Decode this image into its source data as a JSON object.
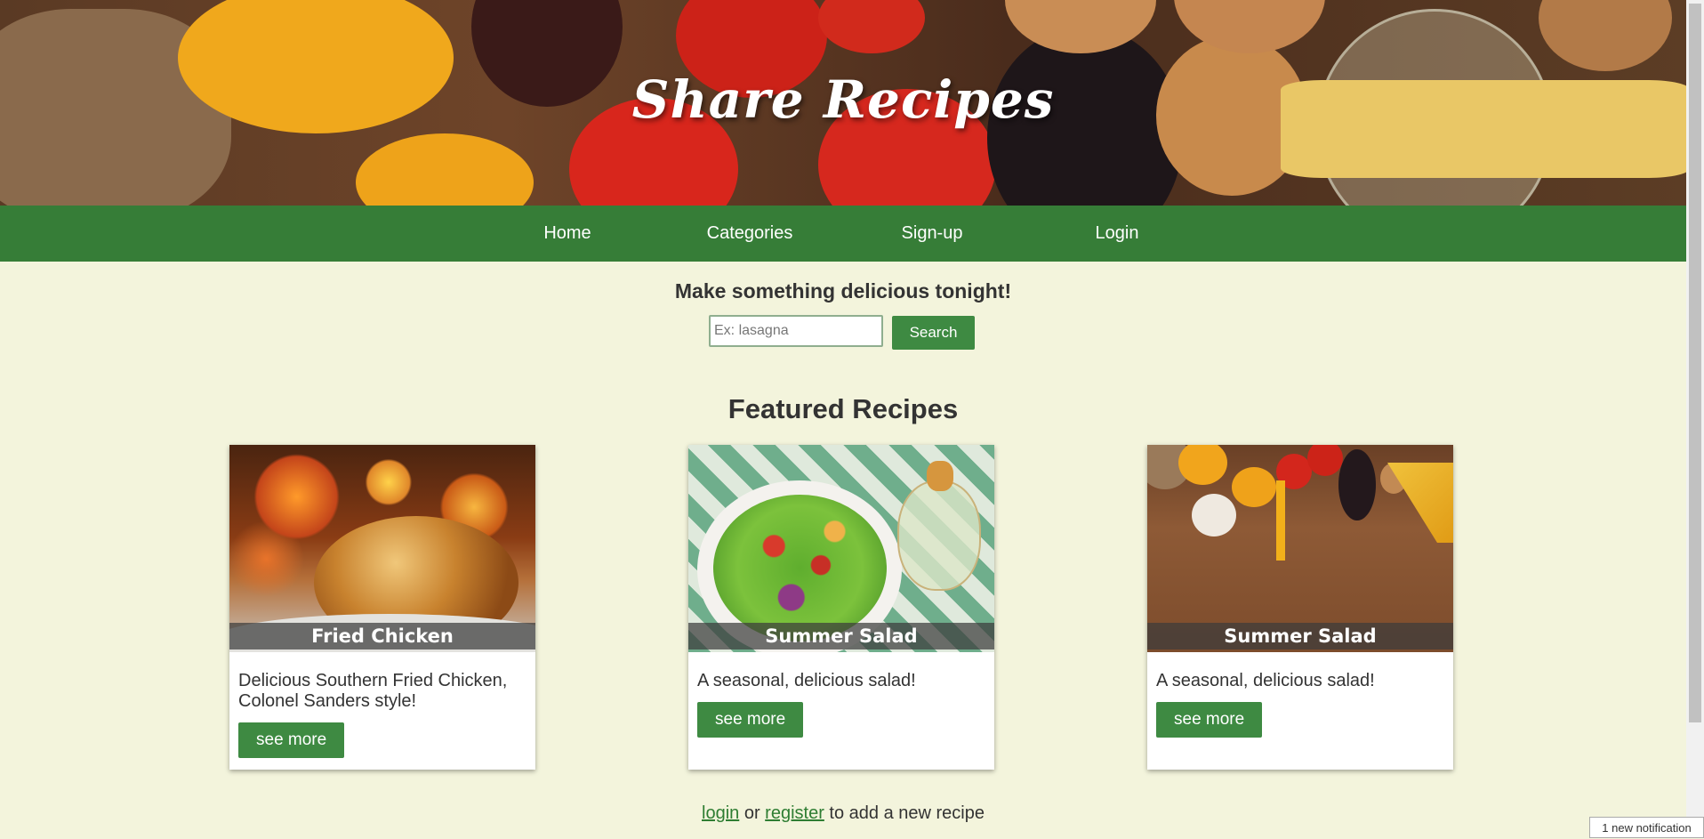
{
  "site": {
    "title": "Share Recipes"
  },
  "nav": {
    "items": [
      {
        "label": "Home"
      },
      {
        "label": "Categories"
      },
      {
        "label": "Sign-up"
      },
      {
        "label": "Login"
      }
    ]
  },
  "search": {
    "tagline": "Make something delicious tonight!",
    "placeholder": "Ex: lasagna",
    "value": "",
    "button_label": "Search"
  },
  "featured": {
    "title": "Featured Recipes",
    "cards": [
      {
        "name": "Fried Chicken",
        "description": "Delicious Southern Fried Chicken, Colonel Sanders style!",
        "button_label": "see more"
      },
      {
        "name": "Summer Salad",
        "description": "A seasonal, delicious salad!",
        "button_label": "see more"
      },
      {
        "name": "Summer Salad",
        "description": "A seasonal, delicious salad!",
        "button_label": "see more"
      }
    ]
  },
  "footer": {
    "login_link": "login",
    "or_text": " or ",
    "register_link": "register",
    "suffix_text": " to add a new recipe"
  },
  "notification": {
    "text": "1 new notification"
  },
  "colors": {
    "nav_green": "#367d37",
    "button_green": "#3e8a42",
    "page_background": "#f3f4dc",
    "link_green": "#2e7d32"
  }
}
